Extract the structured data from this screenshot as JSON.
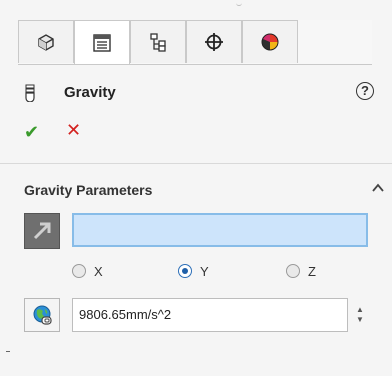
{
  "tabs": [
    {
      "name": "feature-manager",
      "icon": "feature-tree-icon"
    },
    {
      "name": "property-manager",
      "icon": "property-manager-icon",
      "active": true
    },
    {
      "name": "configuration-manager",
      "icon": "configuration-manager-icon"
    },
    {
      "name": "dim-xpert-manager",
      "icon": "crosshair-icon"
    },
    {
      "name": "display-manager",
      "icon": "display-manager-icon"
    }
  ],
  "panel": {
    "title": "Gravity",
    "help_label": "?",
    "ok_label": "✔",
    "cancel_label": "✕"
  },
  "section": {
    "title": "Gravity Parameters",
    "collapse_label": "^"
  },
  "direction": {
    "selection_value": "",
    "options": [
      {
        "label": "X",
        "checked": false
      },
      {
        "label": "Y",
        "checked": true
      },
      {
        "label": "Z",
        "checked": false
      }
    ]
  },
  "magnitude": {
    "value": "9806.65mm/s^2"
  },
  "colors": {
    "ok_green": "#3a9a2c",
    "cancel_red": "#d3211f",
    "selection_fill": "#cde4fb",
    "selection_border": "#87bce8"
  }
}
